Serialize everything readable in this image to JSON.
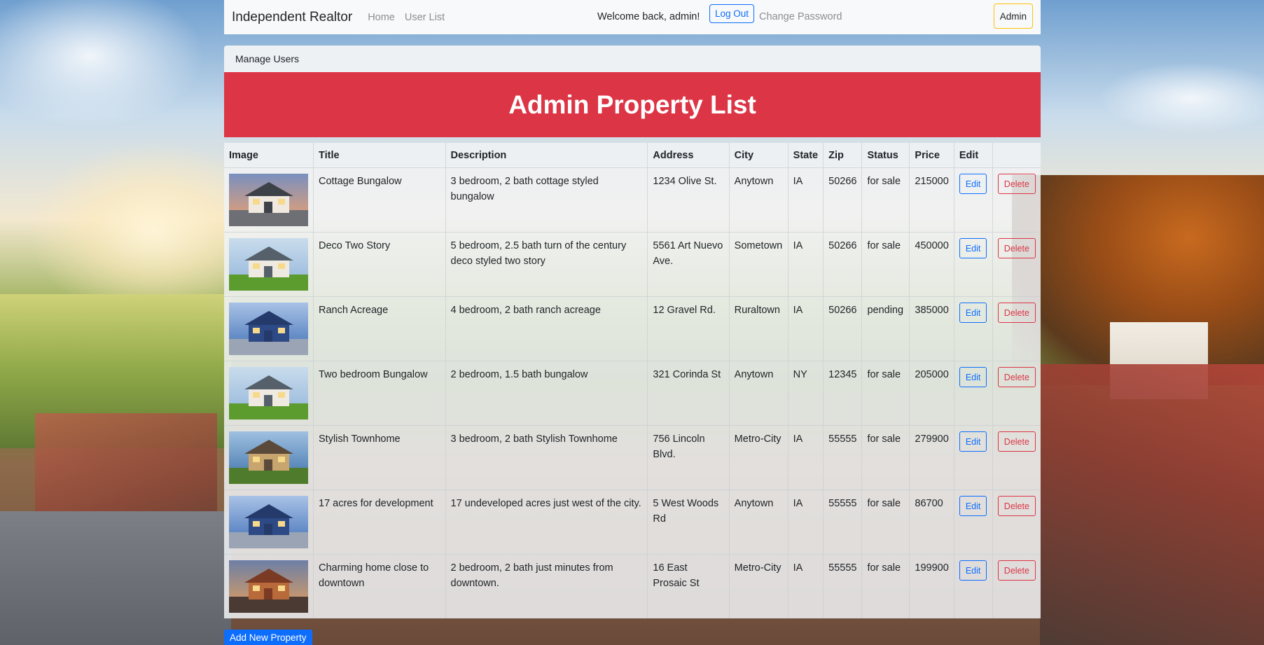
{
  "nav": {
    "brand": "Independent Realtor",
    "home": "Home",
    "user_list": "User List",
    "welcome": "Welcome back, admin!",
    "logout": "Log Out",
    "change_password": "Change Password",
    "admin": "Admin"
  },
  "manage_users": "Manage Users",
  "banner_title": "Admin Property List",
  "table": {
    "headers": [
      "Image",
      "Title",
      "Description",
      "Address",
      "City",
      "State",
      "Zip",
      "Status",
      "Price",
      "Edit",
      ""
    ],
    "edit_label": "Edit",
    "delete_label": "Delete",
    "rows": [
      {
        "title": "Cottage Bungalow",
        "description": "3 bedroom, 2 bath cottage styled bungalow",
        "address": "1234 Olive St.",
        "city": "Anytown",
        "state": "IA",
        "zip": "50266",
        "status": "for sale",
        "price": "215000",
        "image": "house-sunset"
      },
      {
        "title": "Deco Two Story",
        "description": "5 bedroom, 2.5 bath turn of the century deco styled two story",
        "address": "5561 Art Nuevo Ave.",
        "city": "Sometown",
        "state": "IA",
        "zip": "50266",
        "status": "for sale",
        "price": "450000",
        "image": "house-lawn"
      },
      {
        "title": "Ranch Acreage",
        "description": "4 bedroom, 2 bath ranch acreage",
        "address": "12 Gravel Rd.",
        "city": "Ruraltown",
        "state": "IA",
        "zip": "50266",
        "status": "pending",
        "price": "385000",
        "image": "house-blue-dusk"
      },
      {
        "title": "Two bedroom Bungalow",
        "description": "2 bedroom, 1.5 bath bungalow",
        "address": "321 Corinda St",
        "city": "Anytown",
        "state": "NY",
        "zip": "12345",
        "status": "for sale",
        "price": "205000",
        "image": "house-lawn"
      },
      {
        "title": "Stylish Townhome",
        "description": "3 bedroom, 2 bath Stylish Townhome",
        "address": "756 Lincoln Blvd.",
        "city": "Metro-City",
        "state": "IA",
        "zip": "55555",
        "status": "for sale",
        "price": "279900",
        "image": "house-lit-evening"
      },
      {
        "title": "17 acres for development",
        "description": "17 undeveloped acres just west of the city.",
        "address": "5 West Woods Rd",
        "city": "Anytown",
        "state": "IA",
        "zip": "55555",
        "status": "for sale",
        "price": "86700",
        "image": "house-blue-dusk"
      },
      {
        "title": "Charming home close to downtown",
        "description": "2 bedroom, 2 bath just minutes from downtown.",
        "address": "16 East Prosaic St",
        "city": "Metro-City",
        "state": "IA",
        "zip": "55555",
        "status": "for sale",
        "price": "199900",
        "image": "aerial-suburb-dusk"
      }
    ]
  },
  "add_button": "Add New Property",
  "colors": {
    "danger": "#dc3545",
    "primary": "#0d6efd",
    "warning": "#ffc107",
    "navbar_bg": "#f8f9fa"
  }
}
